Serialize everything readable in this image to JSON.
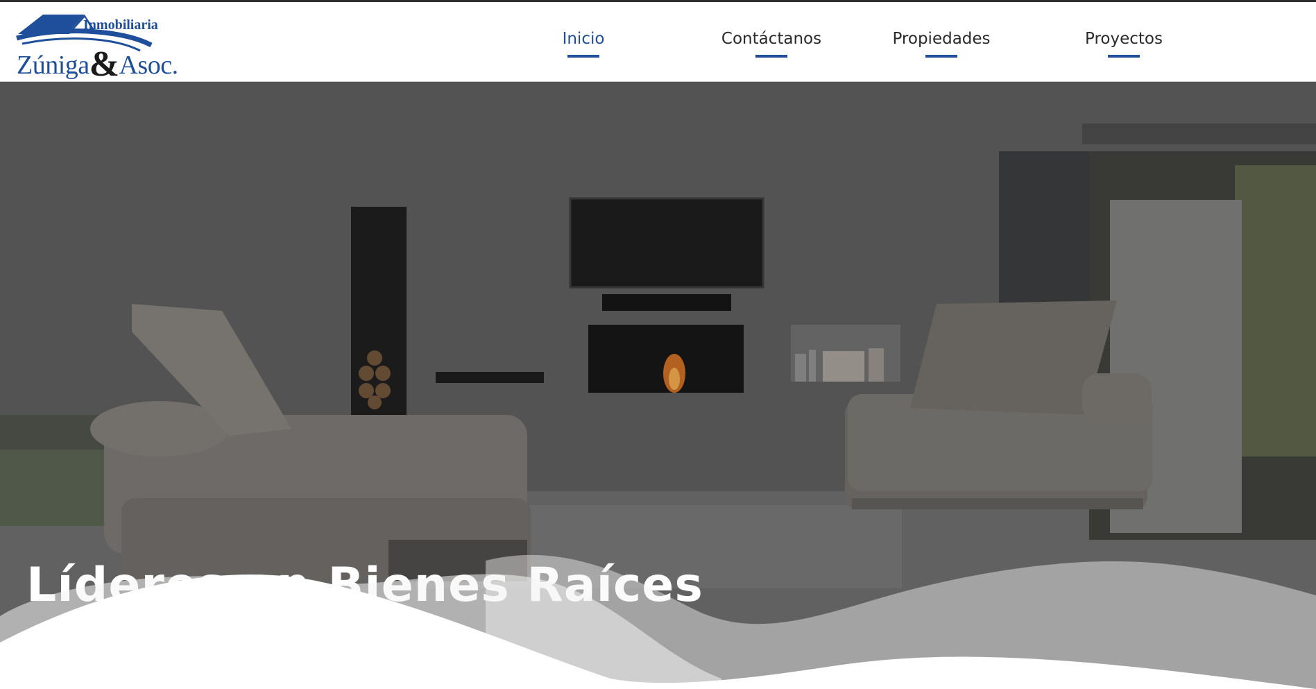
{
  "brand": {
    "small": "Inmobiliaria",
    "name_part1": "Zúniga",
    "ampersand": "&",
    "name_part2": "Asoc.",
    "logo_color": "#1f4f9a"
  },
  "nav": {
    "items": [
      {
        "label": "Inicio",
        "active": true
      },
      {
        "label": "Contáctanos",
        "active": false
      },
      {
        "label": "Propiedades",
        "active": false
      },
      {
        "label": "Proyectos",
        "active": false
      }
    ],
    "accent_color": "#1f4f9a"
  },
  "hero": {
    "title": "Líderes en Bienes Raíces",
    "background": "living-room-with-fireplace-photo"
  }
}
